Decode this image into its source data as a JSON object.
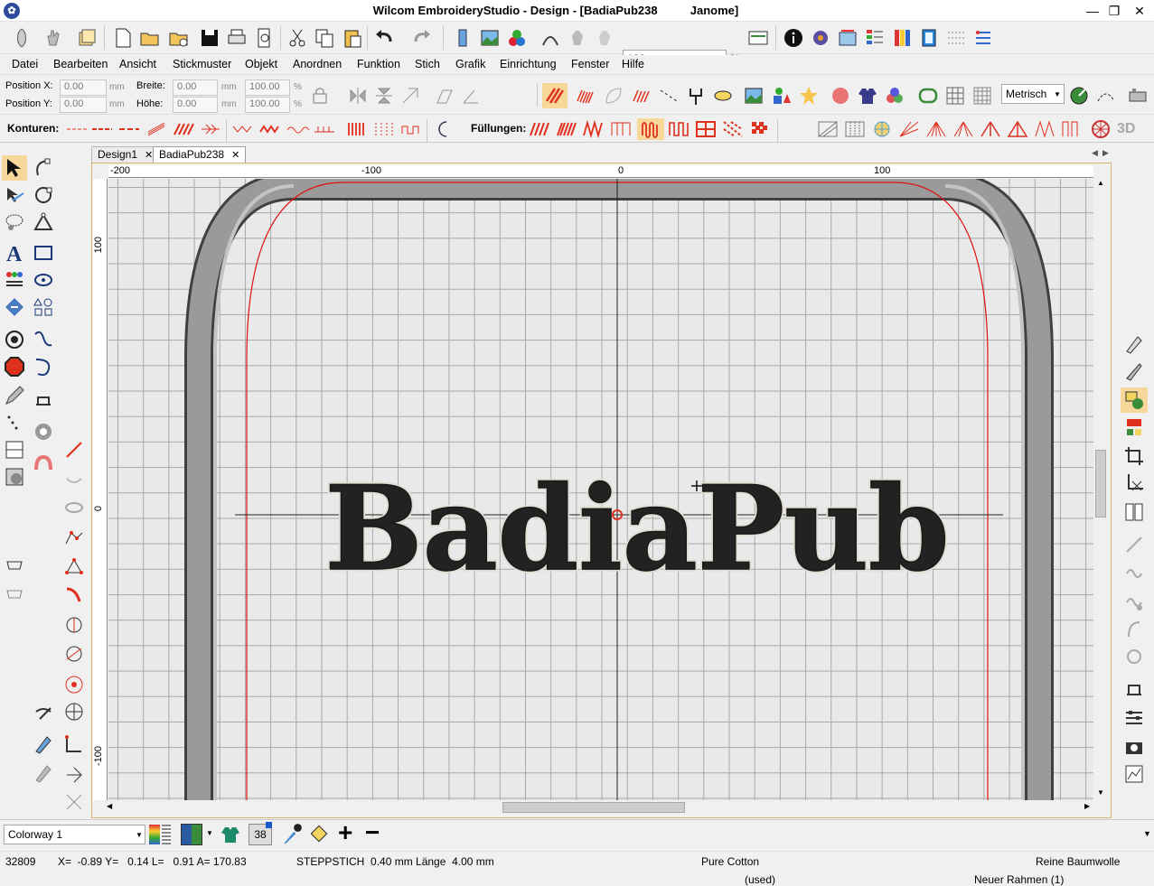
{
  "window": {
    "title": "Wilcom EmbroideryStudio - Design - [BadiaPub238          Janome]",
    "app_icon": "wilcom-logo-icon",
    "controls": [
      "minimize-icon",
      "restore-icon",
      "close-icon"
    ],
    "minimize": "—",
    "restore": "❐",
    "close": "✕"
  },
  "toolbar": {
    "zoom_value": "100",
    "zoom_unit": "%"
  },
  "menu": [
    "Datei",
    "Bearbeiten",
    "Ansicht",
    "Stickmuster",
    "Objekt",
    "Anordnen",
    "Funktion",
    "Stich",
    "Grafik",
    "Einrichtung",
    "Fenster",
    "Hilfe"
  ],
  "properties": {
    "pos_x_label": "Position X:",
    "pos_y_label": "Position Y:",
    "pos_x": "0.00",
    "pos_y": "0.00",
    "width_label": "Breite:",
    "height_label": "Höhe:",
    "width": "0.00",
    "height": "0.00",
    "width_pct": "100.00",
    "height_pct": "100.00",
    "unit_mm": "mm",
    "unit_pct": "%",
    "measure_system": "Metrisch"
  },
  "stitch_toolbar": {
    "outlines_label": "Konturen:",
    "fills_label": "Füllungen:",
    "three_d": "3D"
  },
  "tabs": [
    {
      "label": "Design1",
      "active": false
    },
    {
      "label": "BadiaPub238",
      "active": true
    }
  ],
  "tab_close": "✕",
  "rulers": {
    "top": [
      "-200",
      "-100",
      "0",
      "100"
    ],
    "left": [
      "100",
      "0",
      "-100"
    ]
  },
  "design": {
    "text": "BadiaPub",
    "hoop_color": "#9a9a9a",
    "hoop_inner": "#c4c4c4",
    "hoop_dark": "#404040",
    "border_red": "#e01010",
    "stitch_dark": "#222222",
    "stitch_light": "#e0dcd2"
  },
  "bottom": {
    "colorway": "Colorway 1",
    "thread_count": "38",
    "add": "+",
    "remove": "−"
  },
  "status": {
    "stitch_count": "32809",
    "coords": "X=  -0.89 Y=   0.14 L=   0.91 A= 170.83",
    "stitch_info": "STEPPSTICH  0.40 mm Länge  4.00 mm",
    "thread": "Pure Cotton",
    "thread_used": "(used)",
    "fabric": "Reine Baumwolle",
    "hoop": "Neuer Rahmen (1)"
  },
  "accent_colors": {
    "stitch_red": "#e0301e",
    "tab_border": "#d7b36b",
    "selection": "#0078d7"
  }
}
